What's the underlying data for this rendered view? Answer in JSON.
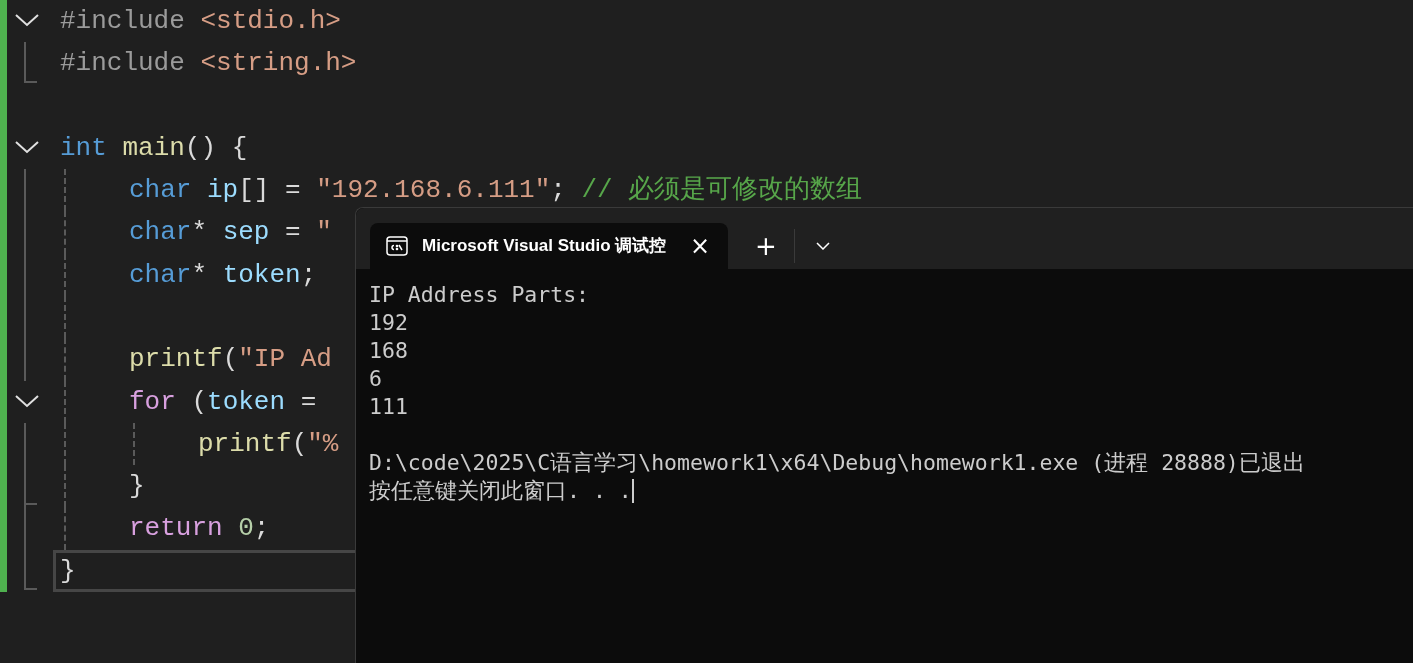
{
  "editor": {
    "lines": [
      {
        "kind": "region",
        "expanded": true,
        "current": false,
        "tokens": [
          {
            "kind": "preprocessor",
            "text": "#include "
          },
          {
            "kind": "string",
            "text": "<stdio.h>"
          }
        ],
        "children": [
          {
            "current": false,
            "tokens": [
              {
                "kind": "preprocessor",
                "text": "#include "
              },
              {
                "kind": "string",
                "text": "<string.h>"
              }
            ]
          }
        ]
      },
      {
        "current": false
      },
      {
        "kind": "block",
        "expanded": true,
        "current": false,
        "tokens": [
          {
            "kind": "keyword",
            "text": "int "
          },
          {
            "kind": "function",
            "text": "main"
          },
          {
            "kind": "plain",
            "text": "() {"
          }
        ],
        "children": [
          {
            "current": false,
            "tokens": [
              {
                "kind": "keyword",
                "text": "char "
              },
              {
                "kind": "variable",
                "text": "ip"
              },
              {
                "kind": "plain",
                "text": "[] = "
              },
              {
                "kind": "string",
                "text": "\"192.168.6.111\""
              },
              {
                "kind": "plain",
                "text": "; "
              },
              {
                "kind": "comment",
                "text": "// 必须是可修改的数组"
              }
            ]
          },
          {
            "current": false,
            "tokens": [
              {
                "kind": "keyword",
                "text": "char"
              },
              {
                "kind": "plain",
                "text": "* "
              },
              {
                "kind": "variable",
                "text": "sep"
              },
              {
                "kind": "plain",
                "text": " = "
              },
              {
                "kind": "string",
                "text": "\""
              }
            ]
          },
          {
            "current": false,
            "tokens": [
              {
                "kind": "keyword",
                "text": "char"
              },
              {
                "kind": "plain",
                "text": "* "
              },
              {
                "kind": "variable",
                "text": "token"
              },
              {
                "kind": "plain",
                "text": ";"
              }
            ]
          },
          {
            "current": false
          },
          {
            "current": false,
            "tokens": [
              {
                "kind": "function",
                "text": "printf"
              },
              {
                "kind": "plain",
                "text": "("
              },
              {
                "kind": "string",
                "text": "\"IP Ad"
              }
            ]
          },
          {
            "kind": "block",
            "expanded": true,
            "current": false,
            "tokens": [
              {
                "kind": "control",
                "text": "for "
              },
              {
                "kind": "plain",
                "text": "("
              },
              {
                "kind": "variable",
                "text": "token"
              },
              {
                "kind": "plain",
                "text": " = "
              }
            ],
            "children": [
              {
                "current": false,
                "tokens": [
                  {
                    "kind": "function",
                    "text": "printf"
                  },
                  {
                    "kind": "plain",
                    "text": "("
                  },
                  {
                    "kind": "string",
                    "text": "\"%"
                  }
                ]
              }
            ]
          },
          {
            "current": false,
            "tokens": [
              {
                "kind": "plain",
                "text": "}"
              }
            ]
          },
          {
            "current": false,
            "tokens": [
              {
                "kind": "control",
                "text": "return "
              },
              {
                "kind": "number",
                "text": "0"
              },
              {
                "kind": "plain",
                "text": ";"
              }
            ]
          }
        ]
      },
      {
        "current": true,
        "tokens": [
          {
            "kind": "plain",
            "text": "}"
          }
        ]
      }
    ]
  },
  "terminal": {
    "tab": {
      "title": "Microsoft Visual Studio 调试控",
      "close": "×"
    },
    "new_tab": "+",
    "output": [
      "IP Address Parts:",
      "192",
      "168",
      "6",
      "111"
    ],
    "exit_message": [
      "D:\\code\\2025\\C语言学习\\homework1\\x64\\Debug\\homework1.exe (进程 28888)已退出",
      "按任意键关闭此窗口. . ."
    ],
    "cursor": true
  }
}
